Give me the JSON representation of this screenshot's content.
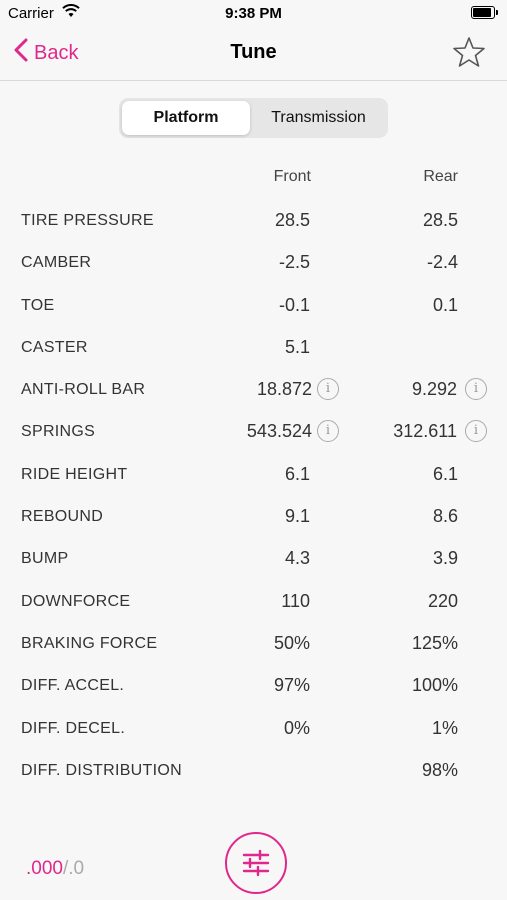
{
  "status_bar": {
    "carrier": "Carrier",
    "time": "9:38 PM",
    "battery_level": 1.0
  },
  "nav": {
    "back_label": "Back",
    "title": "Tune",
    "star_icon": "star-outline-icon",
    "accent_color": "#e0288c"
  },
  "segments": {
    "selected": "Platform",
    "other": "Transmission"
  },
  "columns": {
    "front": "Front",
    "rear": "Rear"
  },
  "rows": [
    {
      "label": "TIRE PRESSURE",
      "front": "28.5",
      "rear": "28.5"
    },
    {
      "label": "CAMBER",
      "front": "-2.5",
      "rear": "-2.4"
    },
    {
      "label": "TOE",
      "front": "-0.1",
      "rear": "0.1"
    },
    {
      "label": "CASTER",
      "front": "5.1",
      "rear": ""
    },
    {
      "label": "ANTI-ROLL BAR",
      "front": "18.872",
      "rear": "9.292",
      "info": true
    },
    {
      "label": "SPRINGS",
      "front": "543.524",
      "rear": "312.611",
      "info": true
    },
    {
      "label": "RIDE HEIGHT",
      "front": "6.1",
      "rear": "6.1"
    },
    {
      "label": "REBOUND",
      "front": "9.1",
      "rear": "8.6"
    },
    {
      "label": "BUMP",
      "front": "4.3",
      "rear": "3.9"
    },
    {
      "label": "DOWNFORCE",
      "front": "110",
      "rear": "220"
    },
    {
      "label": "BRAKING FORCE",
      "front": "50%",
      "rear": "125%"
    },
    {
      "label": "DIFF. ACCEL.",
      "front": "97%",
      "rear": "100%"
    },
    {
      "label": "DIFF. DECEL.",
      "front": "0%",
      "rear": "1%"
    },
    {
      "label": "DIFF. DISTRIBUTION",
      "front": "",
      "rear": "98%"
    }
  ],
  "info_glyph": "i",
  "units": {
    "active": ".000",
    "separator": "/",
    "inactive": ".0"
  },
  "tune_button_icon": "sliders-icon"
}
